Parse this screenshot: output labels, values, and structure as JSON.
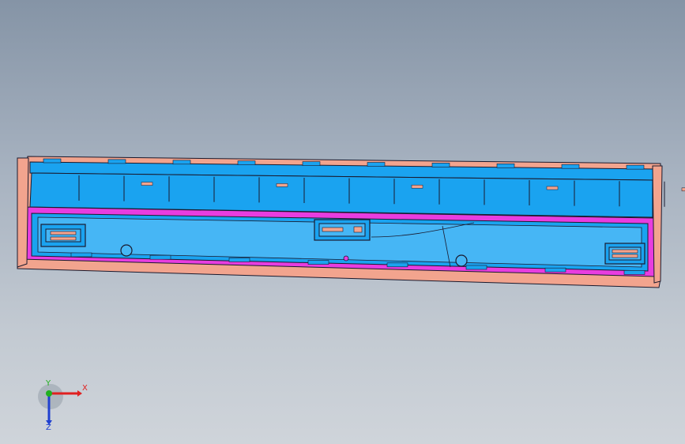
{
  "viewport": {
    "background_top": "#8594a6",
    "background_bottom": "#cfd4da"
  },
  "model": {
    "colors": {
      "outer_frame": "#f2a48e",
      "cavity": "#1aa3f0",
      "cavity_light": "#46b6f5",
      "parting_surface": "#e83de0",
      "edge": "#1a1a2e"
    }
  },
  "triad": {
    "x_label": "X",
    "y_label": "Y",
    "z_label": "Z",
    "x_color": "#e02020",
    "y_color": "#20b020",
    "z_color": "#2040d0"
  }
}
